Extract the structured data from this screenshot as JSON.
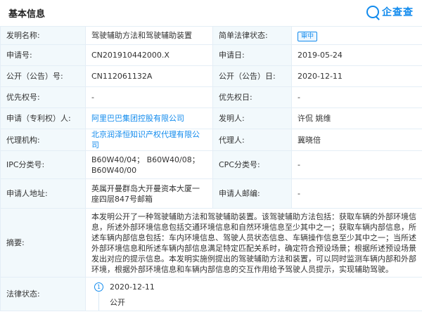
{
  "header": {
    "title": "基本信息",
    "logo_text": "企查查"
  },
  "rows": {
    "invention_name_label": "发明名称:",
    "invention_name": "驾驶辅助方法和驾驶辅助装置",
    "legal_status_label": "简单法律状态:",
    "legal_status": "审中",
    "app_no_label": "申请号:",
    "app_no": "CN201910442000.X",
    "app_date_label": "申请日:",
    "app_date": "2019-05-24",
    "pub_no_label": "公开（公告）号:",
    "pub_no": "CN112061132A",
    "pub_date_label": "公开（公告）日:",
    "pub_date": "2020-12-11",
    "priority_no_label": "优先权号:",
    "priority_no": "-",
    "priority_date_label": "优先权日:",
    "priority_date": "-",
    "applicant_label": "申请（专利权）人:",
    "applicant": "阿里巴巴集团控股有限公司",
    "inventor_label": "发明人:",
    "inventor": "许侃 姚维",
    "agency_label": "代理机构:",
    "agency": "北京润泽恒知识产权代理有限公司",
    "agent_label": "代理人:",
    "agent": "冀晓倍",
    "ipc_label": "IPC分类号:",
    "ipc": "B60W40/04； B60W40/08； B60W40/00",
    "cpc_label": "CPC分类号:",
    "cpc": "-",
    "address_label": "申请人地址:",
    "address": "英属开曼群岛大开曼资本大厦一座四层847号邮箱",
    "postcode_label": "申请人邮编:",
    "postcode": "-",
    "abstract_label": "摘要:",
    "abstract": "本发明公开了一种驾驶辅助方法和驾驶辅助装置。该驾驶辅助方法包括：获取车辆的外部环境信息，所述外部环境信息包括交通环境信息和自然环境信息至少其中之一；获取车辆内部信息，所述车辆内部信息包括：车内环境信息、驾驶人员状态信息、车辆操作信息至少其中之一；当所述外部环境信息和所述车辆内部信息满足特定匹配关系时，确定符合预设场景；根据所述预设场景发出对应的提示信息。本发明实施例提出的驾驶辅助方法和装置，可以同时监测车辆内部和外部环境，根据外部环境信息和车辆内部信息的交互作用给予驾驶人员提示，实现辅助驾驶。",
    "law_status_label": "法律状态:",
    "law_status_step": "1",
    "law_status_date": "2020-12-11",
    "law_status_desc": "公开"
  }
}
